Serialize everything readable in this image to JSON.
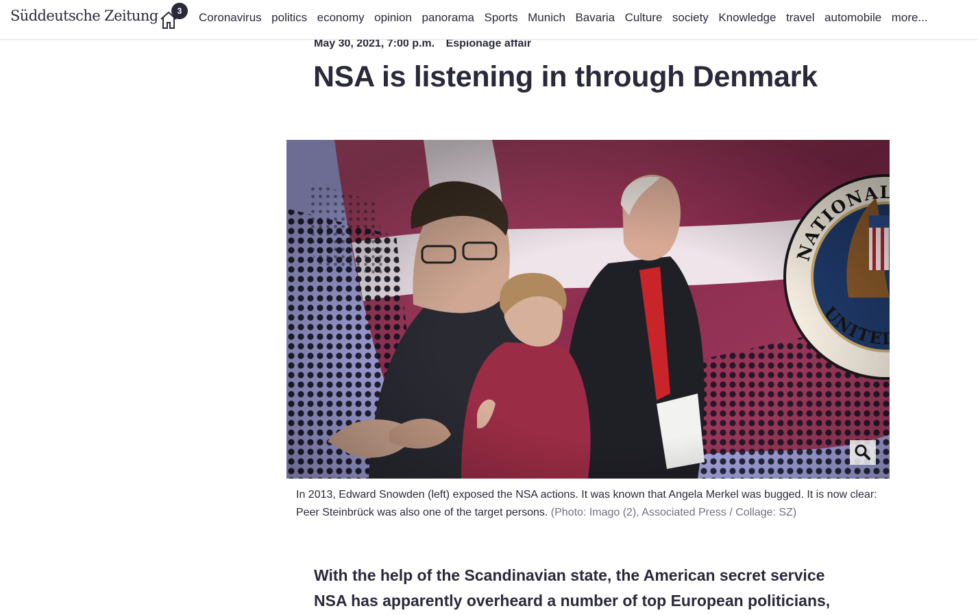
{
  "header": {
    "logo": "Süddeutsche Zeitung",
    "home_badge_count": "3",
    "home_icon": "home-icon",
    "nav": [
      "Coronavirus",
      "politics",
      "economy",
      "opinion",
      "panorama",
      "Sports",
      "Munich",
      "Bavaria",
      "Culture",
      "society",
      "Knowledge",
      "travel",
      "automobile",
      "more..."
    ]
  },
  "article": {
    "date": "May 30, 2021, 7:00 p.m.",
    "kicker": "Espionage affair",
    "headline": "NSA is listening in through Denmark",
    "image": {
      "zoom_icon": "magnifier-icon",
      "seal_text": "NATIONAL SECURITY AGENCY · UNITED STATES",
      "caption": "In 2013, Edward Snowden (left) exposed the NSA actions. It was known that Angela Merkel was bugged. It is now clear: Peer Steinbrück was also one of the target persons.",
      "credit": "(Photo: Imago (2), Associated Press / Collage: SZ)"
    },
    "lead": "With the help of the Scandinavian state, the American secret service NSA has apparently overheard a number of top European politicians,"
  },
  "colors": {
    "text": "#29293a",
    "credit": "#71717f",
    "flag_red": "#a03a5c",
    "photo_backdrop": "#a8a8e4",
    "seal_blue": "#1f3a6b",
    "badge_bg": "#29293a"
  }
}
